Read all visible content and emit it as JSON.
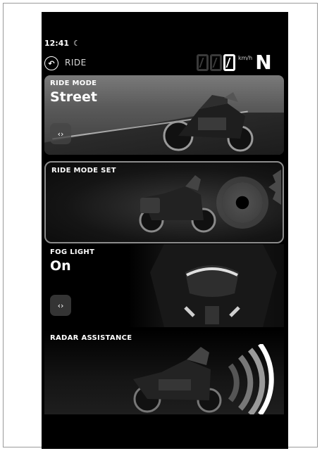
{
  "status": {
    "time": "12:41"
  },
  "header": {
    "title": "RIDE",
    "speed_digits": [
      "",
      "",
      "0"
    ],
    "speed_unit": "km/h",
    "gear": "N"
  },
  "ride_mode": {
    "label": "RIDE MODE",
    "value": "Street",
    "switch_symbol": "‹›"
  },
  "ride_mode_set": {
    "label": "RIDE MODE SET"
  },
  "fog_light": {
    "label": "FOG LIGHT",
    "value": "On",
    "switch_symbol": "‹›"
  },
  "radar_assistance": {
    "label": "RADAR ASSISTANCE"
  },
  "colors": {
    "background": "#000000",
    "text": "#ffffff",
    "inactive_digit": "#3a3a3a",
    "card_border": "#8c8c8c"
  }
}
